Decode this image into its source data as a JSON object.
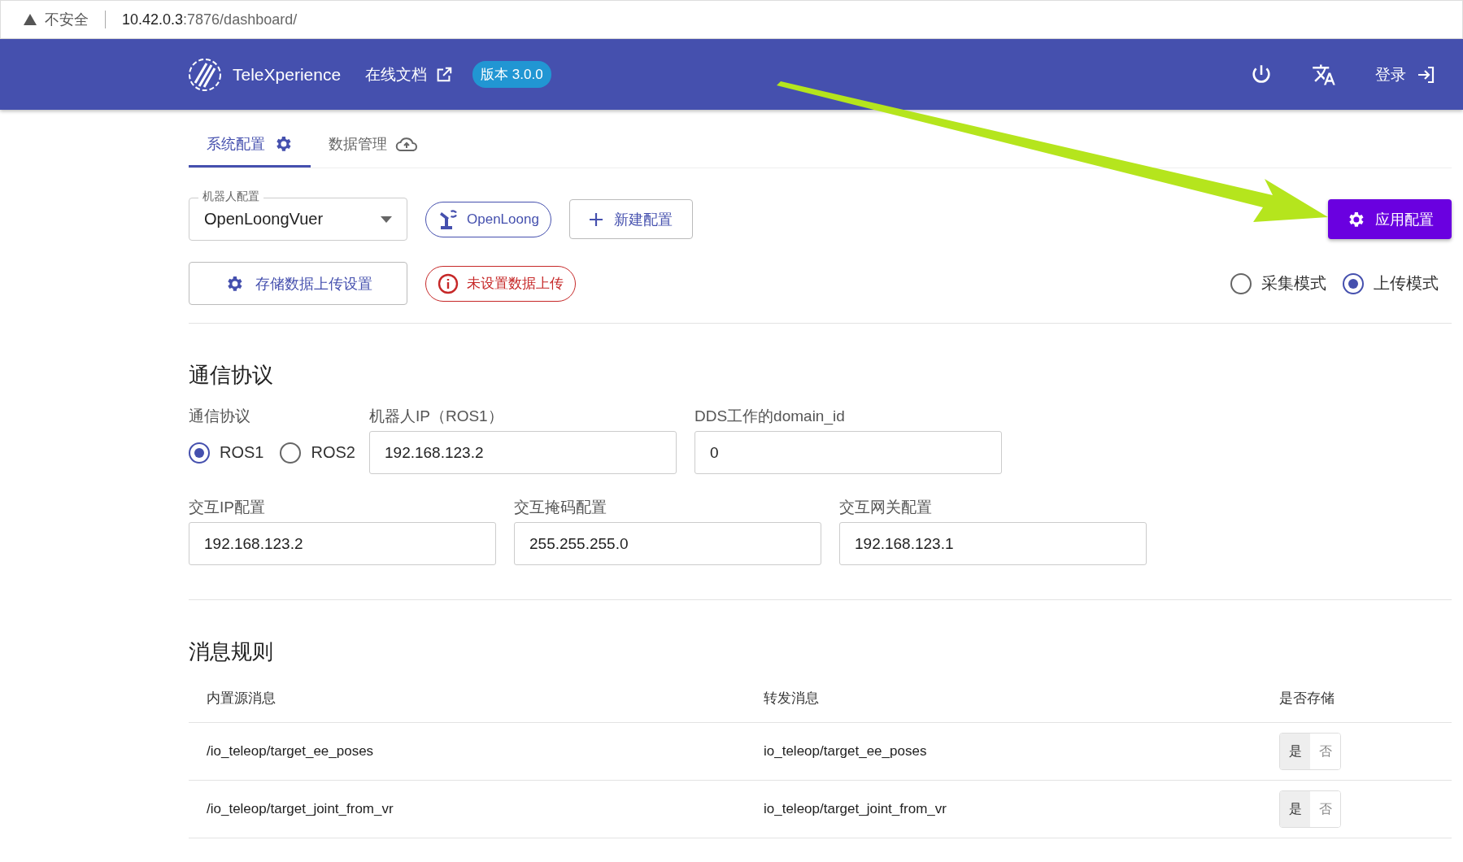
{
  "browser": {
    "security": "不安全",
    "url_host": "10.42.0.3",
    "url_rest": ":7876/dashboard/"
  },
  "header": {
    "title": "TeleXperience",
    "docs_link": "在线文档",
    "version": "版本 3.0.0",
    "login": "登录"
  },
  "tabs": [
    {
      "label": "系统配置",
      "selected": true
    },
    {
      "label": "数据管理",
      "selected": false
    }
  ],
  "robot_config": {
    "label": "机器人配置",
    "value": "OpenLoongVuer"
  },
  "robot_chip": "OpenLoong",
  "new_config_button": "新建配置",
  "apply_button": "应用配置",
  "storage_button": "存储数据上传设置",
  "warning_chip": "未设置数据上传",
  "modes": [
    {
      "label": "采集模式",
      "selected": false
    },
    {
      "label": "上传模式",
      "selected": true
    }
  ],
  "protocol_section": {
    "title": "通信协议",
    "protocol_label": "通信协议",
    "protocols": [
      {
        "label": "ROS1",
        "selected": true
      },
      {
        "label": "ROS2",
        "selected": false
      }
    ],
    "fields": [
      {
        "label": "机器人IP（ROS1）",
        "value": "192.168.123.2"
      },
      {
        "label": "DDS工作的domain_id",
        "value": "0"
      }
    ],
    "fields_row2": [
      {
        "label": "交互IP配置",
        "value": "192.168.123.2"
      },
      {
        "label": "交互掩码配置",
        "value": "255.255.255.0"
      },
      {
        "label": "交互网关配置",
        "value": "192.168.123.1"
      }
    ]
  },
  "rules_section": {
    "title": "消息规则",
    "columns": [
      "内置源消息",
      "转发消息",
      "是否存储"
    ],
    "rows": [
      {
        "source": "/io_teleop/target_ee_poses",
        "forward": "io_teleop/target_ee_poses",
        "yes": "是",
        "no": "否",
        "store": true
      },
      {
        "source": "/io_teleop/target_joint_from_vr",
        "forward": "io_teleop/target_joint_from_vr",
        "yes": "是",
        "no": "否",
        "store": true
      }
    ]
  }
}
